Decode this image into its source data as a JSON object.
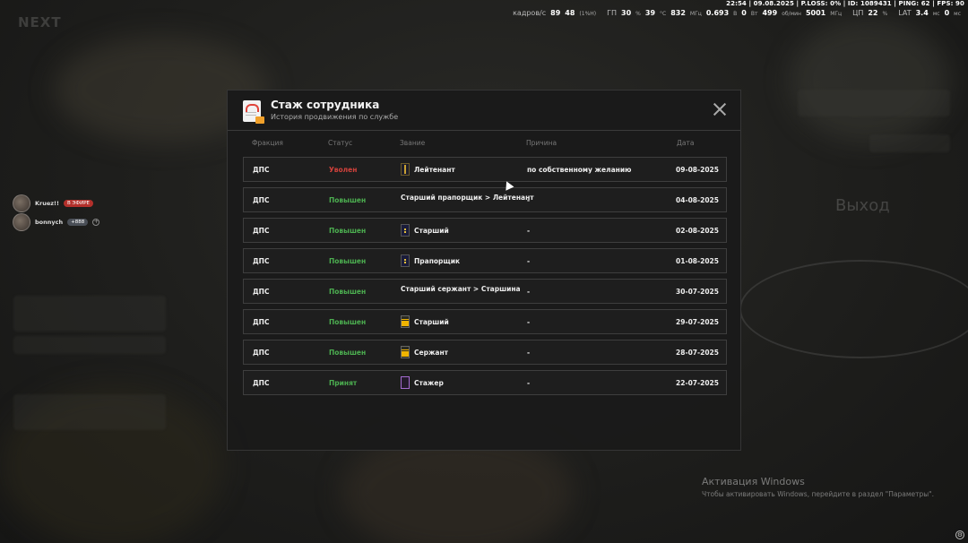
{
  "status_bar": {
    "top_line": "22:54 | 09.08.2025 | P.LOSS: 0% | ID: 1089431 | PING: 62 | FPS: 90",
    "fps_label": "кадров/с",
    "fps_value": "89",
    "fps_low": "48",
    "fps_low_unit": "(1%H)",
    "gpu_label": "ГП",
    "gpu_load": "30",
    "gpu_load_unit": "%",
    "gpu_temp": "39",
    "gpu_temp_unit": "°C",
    "gpu_clock": "832",
    "gpu_clock_unit": "МГц",
    "gpu_volt": "0.693",
    "gpu_volt_unit": "В",
    "gpu_power": "0",
    "gpu_power_unit": "Вт",
    "fan": "499",
    "fan_unit": "об/мин",
    "mem_clock": "5001",
    "mem_clock_unit": "МГц",
    "cpu_label": "ЦП",
    "cpu_load": "22",
    "cpu_load_unit": "%",
    "lat_label": "LAT",
    "lat_value": "3.4",
    "lat_unit": "мс",
    "lat_value2": "0",
    "lat_unit2": "мс"
  },
  "voice": [
    {
      "name": "Kruez!!",
      "badge": "В ЭФИРЕ"
    },
    {
      "name": "bonnych",
      "badge": "+888"
    }
  ],
  "modal": {
    "title": "Стаж сотрудника",
    "subtitle": "История продвижения по службе",
    "columns": {
      "faction": "Фракция",
      "status": "Статус",
      "rank": "Звание",
      "reason": "Причина",
      "date": "Дата"
    },
    "rows": [
      {
        "faction": "ДПС",
        "status": "Уволен",
        "status_kind": "red",
        "rank": "Лейтенант",
        "rank_icon": "lieutenant-insignia-icon",
        "reason": "по собственному желанию",
        "date": "09-08-2025"
      },
      {
        "faction": "ДПС",
        "status": "Повышен",
        "status_kind": "green",
        "rank": "Старший прапорщик > Лейтенант",
        "rank_icon": "",
        "reason": "-",
        "date": "04-08-2025"
      },
      {
        "faction": "ДПС",
        "status": "Повышен",
        "status_kind": "green",
        "rank": "Старший",
        "rank_icon": "senior-warrant-insignia-icon",
        "reason": "-",
        "date": "02-08-2025"
      },
      {
        "faction": "ДПС",
        "status": "Повышен",
        "status_kind": "green",
        "rank": "Прапорщик",
        "rank_icon": "warrant-insignia-icon",
        "reason": "-",
        "date": "01-08-2025"
      },
      {
        "faction": "ДПС",
        "status": "Повышен",
        "status_kind": "green",
        "rank": "Старший сержант > Старшина",
        "rank_icon": "",
        "reason": "-",
        "date": "30-07-2025"
      },
      {
        "faction": "ДПС",
        "status": "Повышен",
        "status_kind": "green",
        "rank": "Старший",
        "rank_icon": "senior-sergeant-insignia-icon",
        "reason": "-",
        "date": "29-07-2025"
      },
      {
        "faction": "ДПС",
        "status": "Повышен",
        "status_kind": "green",
        "rank": "Сержант",
        "rank_icon": "sergeant-insignia-icon",
        "reason": "-",
        "date": "28-07-2025"
      },
      {
        "faction": "ДПС",
        "status": "Принят",
        "status_kind": "green",
        "rank": "Стажер",
        "rank_icon": "cadet-insignia-icon",
        "reason": "-",
        "date": "22-07-2025"
      }
    ]
  },
  "background": {
    "exit_label": "Выход"
  },
  "watermark": {
    "title": "Активация Windows",
    "subtitle": "Чтобы активировать Windows, перейдите в раздел \"Параметры\"."
  },
  "colors": {
    "status_red": "#d0413b",
    "status_green": "#4caf50",
    "modal_bg": "#1a1a1a"
  }
}
